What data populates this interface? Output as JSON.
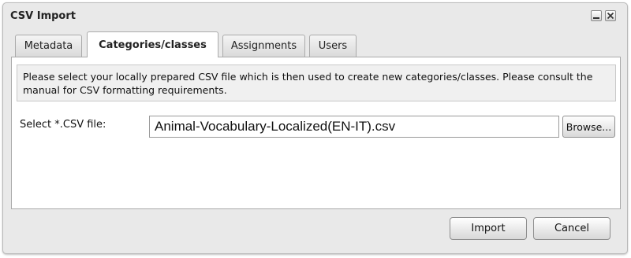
{
  "window": {
    "title": "CSV Import",
    "minimize_icon": "minimize-icon",
    "close_icon": "close-icon"
  },
  "tabs": [
    {
      "label": "Metadata",
      "active": false
    },
    {
      "label": "Categories/classes",
      "active": true
    },
    {
      "label": "Assignments",
      "active": false
    },
    {
      "label": "Users",
      "active": false
    }
  ],
  "main": {
    "info_text": "Please select your locally prepared CSV file which is then used to create new categories/classes. Please consult the manual for CSV formatting requirements.",
    "file_label": "Select *.CSV file:",
    "file_value": "Animal-Vocabulary-Localized(EN-IT).csv",
    "browse_label": "Browse..."
  },
  "footer": {
    "import_label": "Import",
    "cancel_label": "Cancel"
  }
}
